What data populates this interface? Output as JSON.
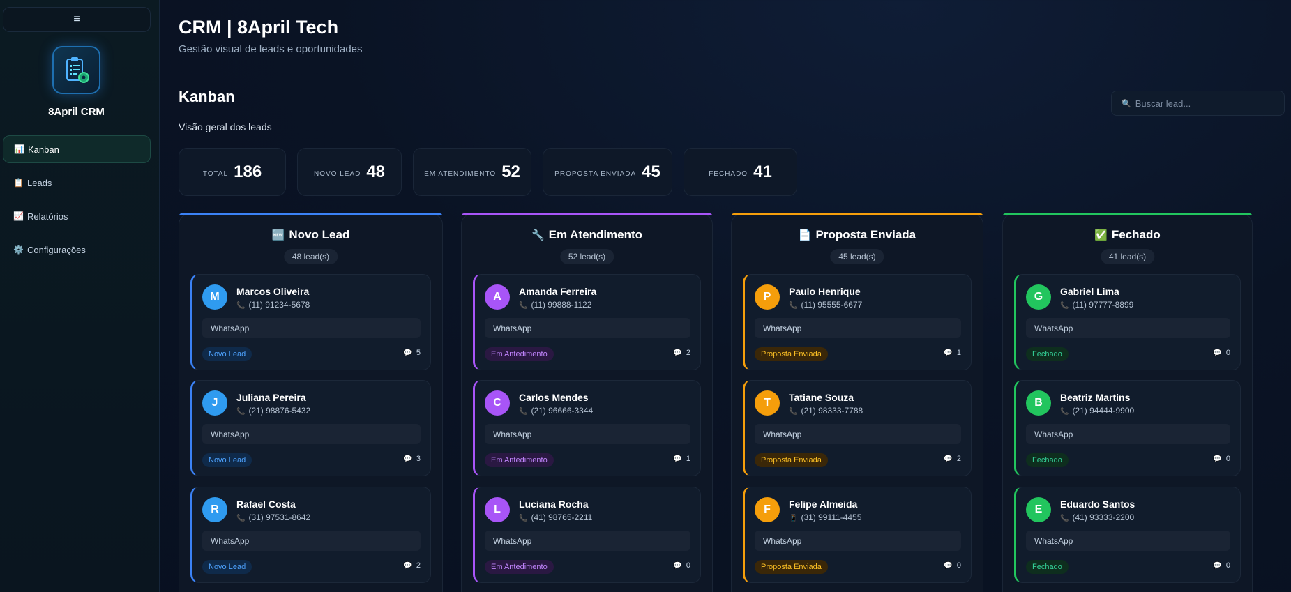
{
  "sidebar": {
    "toggle": "≡",
    "brand": "8April CRM",
    "items": [
      {
        "icon": "📊",
        "label": "Kanban",
        "active": true
      },
      {
        "icon": "📋",
        "label": "Leads"
      },
      {
        "icon": "📈",
        "label": "Relatórios"
      },
      {
        "icon": "⚙️",
        "label": "Configurações"
      }
    ]
  },
  "header": {
    "title": "CRM | 8April Tech",
    "subtitle": "Gestão visual de leads e oportunidades"
  },
  "section": {
    "title": "Kanban",
    "subtitle": "Visão geral dos leads"
  },
  "search": {
    "icon": "🔍",
    "placeholder": "Buscar lead..."
  },
  "stats": [
    {
      "label": "Total",
      "value": "186"
    },
    {
      "label": "Novo Lead",
      "value": "48"
    },
    {
      "label": "Em Atendimento",
      "value": "52"
    },
    {
      "label": "Proposta Enviada",
      "value": "45"
    },
    {
      "label": "Fechado",
      "value": "41"
    }
  ],
  "columns": [
    {
      "icon": "🆕",
      "title": "Novo Lead",
      "count": "48 lead(s)",
      "accent": "#3b82f6",
      "avatar_color": "#2f9bf0",
      "badge_bg": "#0f2a4a",
      "badge_fg": "#4ea3ff",
      "leads": [
        {
          "initial": "M",
          "name": "Marcos Oliveira",
          "phone_icon": "📞",
          "phone": "(11) 91234-5678",
          "channel": "WhatsApp",
          "badge": "Novo Lead",
          "comment_icon": "💬",
          "comments": "5"
        },
        {
          "initial": "J",
          "name": "Juliana Pereira",
          "phone_icon": "📞",
          "phone": "(21) 98876-5432",
          "channel": "WhatsApp",
          "badge": "Novo Lead",
          "comment_icon": "💬",
          "comments": "3"
        },
        {
          "initial": "R",
          "name": "Rafael Costa",
          "phone_icon": "📞",
          "phone": "(31) 97531-8642",
          "channel": "WhatsApp",
          "badge": "Novo Lead",
          "comment_icon": "💬",
          "comments": "2"
        }
      ]
    },
    {
      "icon": "🔧",
      "title": "Em Atendimento",
      "count": "52 lead(s)",
      "accent": "#a855f7",
      "avatar_color": "#a855f7",
      "badge_bg": "#2a1842",
      "badge_fg": "#c084fc",
      "leads": [
        {
          "initial": "A",
          "name": "Amanda Ferreira",
          "phone_icon": "📞",
          "phone": "(11) 99888-1122",
          "channel": "WhatsApp",
          "badge": "Em Antedimento",
          "comment_icon": "💬",
          "comments": "2"
        },
        {
          "initial": "C",
          "name": "Carlos Mendes",
          "phone_icon": "📞",
          "phone": "(21) 96666-3344",
          "channel": "WhatsApp",
          "badge": "Em Antedimento",
          "comment_icon": "💬",
          "comments": "1"
        },
        {
          "initial": "L",
          "name": "Luciana Rocha",
          "phone_icon": "📞",
          "phone": "(41) 98765-2211",
          "channel": "WhatsApp",
          "badge": "Em Antedimento",
          "comment_icon": "💬",
          "comments": "0"
        }
      ]
    },
    {
      "icon": "📄",
      "title": "Proposta Enviada",
      "count": "45 lead(s)",
      "accent": "#f59e0b",
      "avatar_color": "#f59e0b",
      "badge_bg": "#3a2708",
      "badge_fg": "#fbbf24",
      "leads": [
        {
          "initial": "P",
          "name": "Paulo Henrique",
          "phone_icon": "📞",
          "phone": "(11) 95555-6677",
          "channel": "WhatsApp",
          "badge": "Proposta Enviada",
          "comment_icon": "💬",
          "comments": "1"
        },
        {
          "initial": "T",
          "name": "Tatiane Souza",
          "phone_icon": "📞",
          "phone": "(21) 98333-7788",
          "channel": "WhatsApp",
          "badge": "Proposta Enviada",
          "comment_icon": "💬",
          "comments": "2"
        },
        {
          "initial": "F",
          "name": "Felipe Almeida",
          "phone_icon": "📱",
          "phone": "(31) 99111-4455",
          "channel": "WhatsApp",
          "badge": "Proposta Enviada",
          "comment_icon": "💬",
          "comments": "0"
        }
      ]
    },
    {
      "icon": "✅",
      "title": "Fechado",
      "count": "41 lead(s)",
      "accent": "#22c55e",
      "avatar_color": "#22c55e",
      "badge_bg": "#0e2e1e",
      "badge_fg": "#34d399",
      "leads": [
        {
          "initial": "G",
          "name": "Gabriel Lima",
          "phone_icon": "📞",
          "phone": "(11) 97777-8899",
          "channel": "WhatsApp",
          "badge": "Fechado",
          "comment_icon": "💬",
          "comments": "0"
        },
        {
          "initial": "B",
          "name": "Beatriz Martins",
          "phone_icon": "📞",
          "phone": "(21) 94444-9900",
          "channel": "WhatsApp",
          "badge": "Fechado",
          "comment_icon": "💬",
          "comments": "0"
        },
        {
          "initial": "E",
          "name": "Eduardo Santos",
          "phone_icon": "📞",
          "phone": "(41) 93333-2200",
          "channel": "WhatsApp",
          "badge": "Fechado",
          "comment_icon": "💬",
          "comments": "0"
        }
      ]
    }
  ]
}
